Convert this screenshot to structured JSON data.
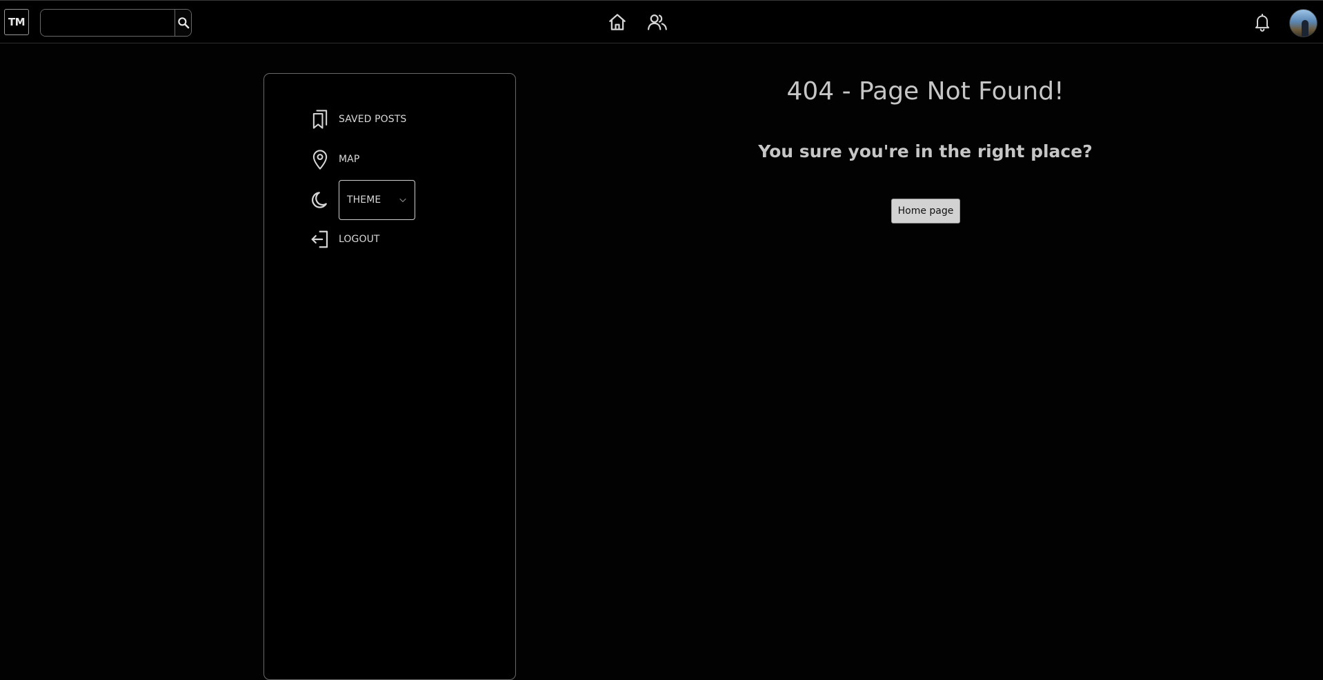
{
  "topbar": {
    "logo_text": "TM",
    "search": {
      "placeholder": "",
      "value": ""
    },
    "icons": {
      "search": "search-icon",
      "home": "home-icon",
      "friends": "friends-icon",
      "notifications": "bell-icon",
      "avatar": "user-avatar"
    }
  },
  "sidebar": {
    "items": [
      {
        "label": "SAVED POSTS",
        "icon": "bookmarks-icon"
      },
      {
        "label": "MAP",
        "icon": "map-pin-icon"
      },
      {
        "label": "THEME",
        "icon": "moon-icon",
        "type": "select"
      },
      {
        "label": "LOGOUT",
        "icon": "logout-icon"
      }
    ]
  },
  "main": {
    "title": "404 - Page Not Found!",
    "subtitle": "You sure you're in the right place?",
    "home_button": "Home page"
  },
  "colors": {
    "background": "#020203",
    "text": "#c6c6c6",
    "border": "#6a6a6a",
    "button_bg": "#d2d2d2"
  }
}
